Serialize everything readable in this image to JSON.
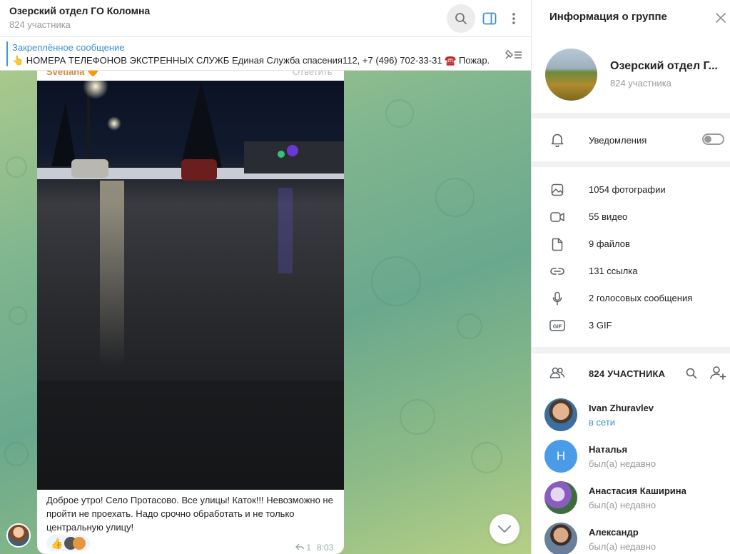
{
  "chat": {
    "title": "Озерский отдел ГО Коломна",
    "subtitle": "824 участника",
    "pinned": {
      "label": "Закреплённое сообщение",
      "text": "👆 НОМЕРА ТЕЛЕФОНОВ ЭКСТРЕННЫХ СЛУЖБ  Единая Служба спасения112,  +7 (496) 702-33-31 ☎️  Пожар..."
    },
    "message": {
      "sender": "Svetlana 🧡",
      "reply_label": "Ответить",
      "text": "Доброе утро! Село Протасово. Все улицы! Каток!!! Невозможно не пройти не проехать. Надо срочно обработать и не только центральную улицу!",
      "replies": "1",
      "time": "8:03"
    }
  },
  "info": {
    "title": "Информация о группе",
    "group_name": "Озерский отдел Г...",
    "group_count": "824 участника",
    "notifications_label": "Уведомления",
    "notifications_on": false,
    "media": [
      {
        "icon": "photo-icon",
        "label": "1054 фотографии"
      },
      {
        "icon": "video-icon",
        "label": "55 видео"
      },
      {
        "icon": "file-icon",
        "label": "9 файлов"
      },
      {
        "icon": "link-icon",
        "label": "131 ссылка"
      },
      {
        "icon": "microphone-icon",
        "label": "2 голосовых сообщения"
      },
      {
        "icon": "gif-icon",
        "label": "3 GIF"
      }
    ],
    "members_title": "824 УЧАСТНИКА",
    "members": [
      {
        "name": "Ivan Zhuravlev",
        "status": "в сети",
        "online": true
      },
      {
        "name": "Наталья",
        "status": "был(а) недавно",
        "online": false,
        "initial": "Н"
      },
      {
        "name": "Анастасия Каширина",
        "status": "был(а) недавно",
        "online": false
      },
      {
        "name": "Александр",
        "status": "был(а) недавно",
        "online": false
      }
    ]
  },
  "colors": {
    "accent": "#3a8fd1",
    "sender": "#d08a3c",
    "avatar_blue": "#4a9be8"
  }
}
